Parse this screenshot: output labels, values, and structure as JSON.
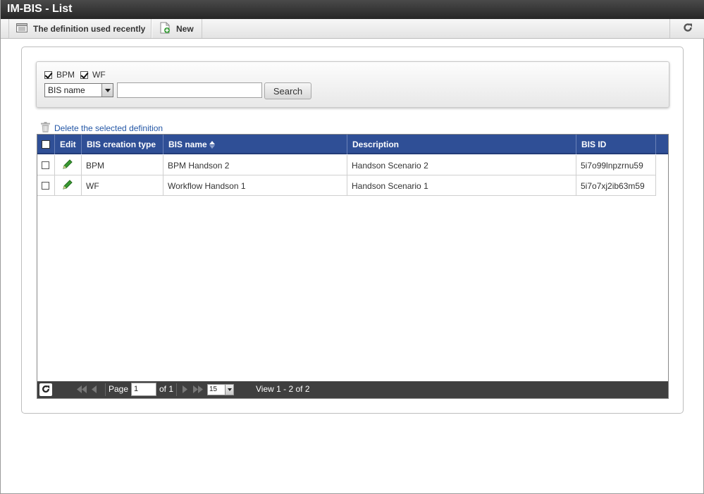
{
  "window": {
    "title": "IM-BIS - List"
  },
  "toolbar": {
    "recent_label": "The definition used recently",
    "new_label": "New",
    "recent_icon": "list-icon",
    "new_icon": "new-document-icon",
    "refresh_icon": "refresh-icon"
  },
  "search": {
    "checkboxes": [
      {
        "label": "BPM",
        "checked": true
      },
      {
        "label": "WF",
        "checked": true
      }
    ],
    "field_select": "BIS name",
    "query": "",
    "button_label": "Search"
  },
  "actions": {
    "delete_label": "Delete the selected definition",
    "delete_icon": "trash-icon"
  },
  "grid": {
    "columns": [
      "Edit",
      "BIS creation type",
      "BIS name",
      "Description",
      "BIS ID"
    ],
    "sort_column": "BIS name",
    "rows": [
      {
        "type": "BPM",
        "name": "BPM Handson 2",
        "description": "Handson Scenario 2",
        "id": "5i7o99lnpzrnu59"
      },
      {
        "type": "WF",
        "name": "Workflow Handson 1",
        "description": "Handson Scenario 1",
        "id": "5i7o7xj2ib63m59"
      }
    ]
  },
  "pager": {
    "page_label": "Page",
    "page_value": "1",
    "of_label": "of 1",
    "rows_per_page": "15",
    "view_text": "View 1 - 2 of 2"
  },
  "colors": {
    "header_blue": "#2f4f96",
    "link_blue": "#2457a6",
    "pager_bg": "#3f3f3f"
  }
}
